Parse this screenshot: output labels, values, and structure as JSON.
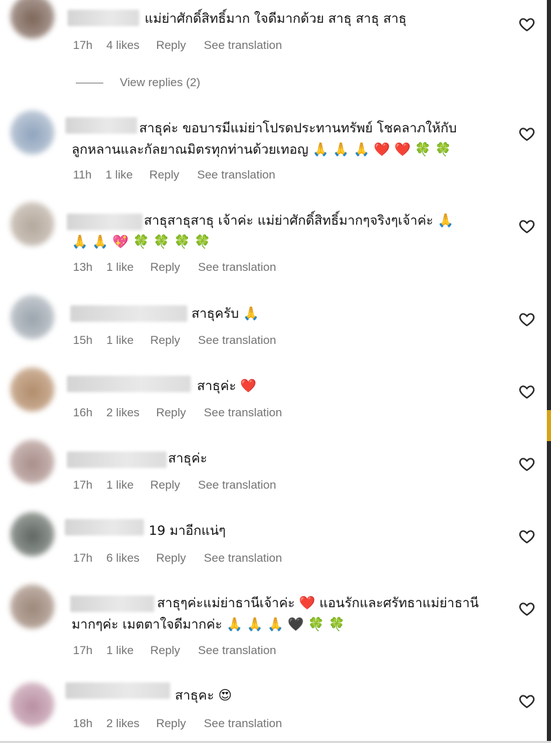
{
  "comments": [
    {
      "text": "แม่ย่าศักดิ์สิทธิ์มาก ใจดีมากด้วย สาธุ สาธุ สาธุ",
      "time": "17h",
      "likes": "4 likes",
      "reply": "Reply",
      "translate": "See translation"
    },
    {
      "text": "สาธุค่ะ ขอบารมีแม่ย่าโปรดประทานทรัพย์ โชคลาภให้กับ\nลูกหลานและกัลยาณมิตรทุกท่านด้วยเทอญ 🙏 🙏 🙏 ❤️ ❤️ 🍀 🍀",
      "time": "11h",
      "likes": "1 like",
      "reply": "Reply",
      "translate": "See translation"
    },
    {
      "text": "สาธุสาธุสาธุ เจ้าค่ะ แม่ย่าศักดิ์สิทธิ์มากๆจริงๆเจ้าค่ะ 🙏\n🙏 🙏 💖 🍀 🍀 🍀 🍀",
      "time": "13h",
      "likes": "1 like",
      "reply": "Reply",
      "translate": "See translation"
    },
    {
      "text": "สาธุครับ 🙏",
      "time": "15h",
      "likes": "1 like",
      "reply": "Reply",
      "translate": "See translation"
    },
    {
      "text": "สาธุค่ะ ❤️",
      "time": "16h",
      "likes": "2 likes",
      "reply": "Reply",
      "translate": "See translation"
    },
    {
      "text": "สาธุค่ะ",
      "time": "17h",
      "likes": "1 like",
      "reply": "Reply",
      "translate": "See translation"
    },
    {
      "text": "19 มาอีกแน่ๆ",
      "time": "17h",
      "likes": "6 likes",
      "reply": "Reply",
      "translate": "See translation"
    },
    {
      "text": "สาธุๆค่ะแม่ย่าธานีเจ้าค่ะ ❤️ แอนรักและศรัทธาแม่ย่าธานี\nมากๆค่ะ เมตตาใจดีมากค่ะ 🙏 🙏 🙏 🖤 🍀 🍀",
      "time": "17h",
      "likes": "1 like",
      "reply": "Reply",
      "translate": "See translation"
    },
    {
      "text": "สาธุคะ 😍",
      "time": "18h",
      "likes": "2 likes",
      "reply": "Reply",
      "translate": "See translation"
    }
  ],
  "view_replies": "View replies (2)",
  "icons": {
    "like": "heart-outline-icon"
  },
  "colors": {
    "meta_text": "#737373",
    "text": "#111111"
  }
}
